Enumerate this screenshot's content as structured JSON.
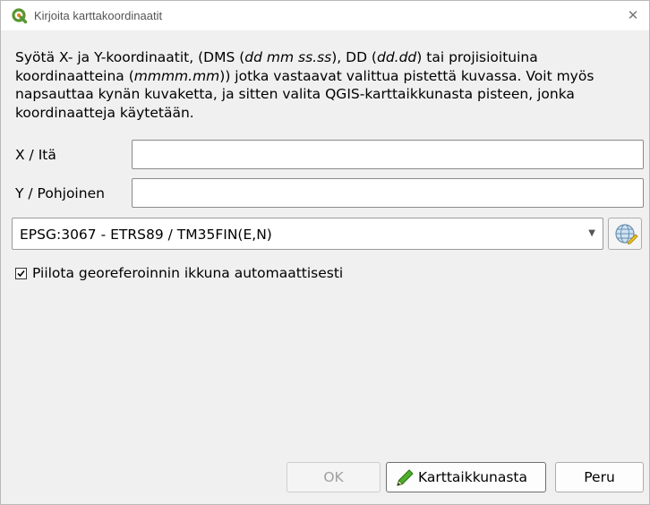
{
  "window": {
    "title": "Kirjoita karttakoordinaatit",
    "close_symbol": "✕",
    "app_icon": "qgis-logo-icon"
  },
  "description": {
    "part1": "Syötä X- ja Y-koordinaatit, (DMS (",
    "dms_format": "dd mm ss.ss",
    "part2": "), DD (",
    "dd_format": "dd.dd",
    "part3": ") tai projisioituina koordinaatteina (",
    "proj_format": "mmmm.mm",
    "part4": ")) jotka vastaavat valittua pistettä kuvassa. Voit myös napsauttaa kynän kuvaketta, ja sitten valita QGIS-karttaikkunasta pisteen, jonka koordinaatteja käytetään."
  },
  "fields": {
    "x_label": "X / Itä",
    "x_value": "",
    "y_label": "Y / Pohjoinen",
    "y_value": ""
  },
  "crs": {
    "selected": "EPSG:3067 - ETRS89 / TM35FIN(E,N)",
    "dropdown_icon": "chevron-down-icon",
    "select_button_icon": "globe-crs-icon"
  },
  "options": {
    "hide_window_label": "Piilota georeferoinnin ikkuna automaattisesti",
    "hide_window_checked": true
  },
  "buttons": {
    "ok_label": "OK",
    "ok_enabled": false,
    "from_map_label": "Karttaikkunasta",
    "from_map_icon": "pencil-icon",
    "cancel_label": "Peru"
  },
  "colors": {
    "qgis_green": "#589632",
    "qgis_yellow": "#ee7913",
    "pencil_green": "#4caf2a"
  }
}
